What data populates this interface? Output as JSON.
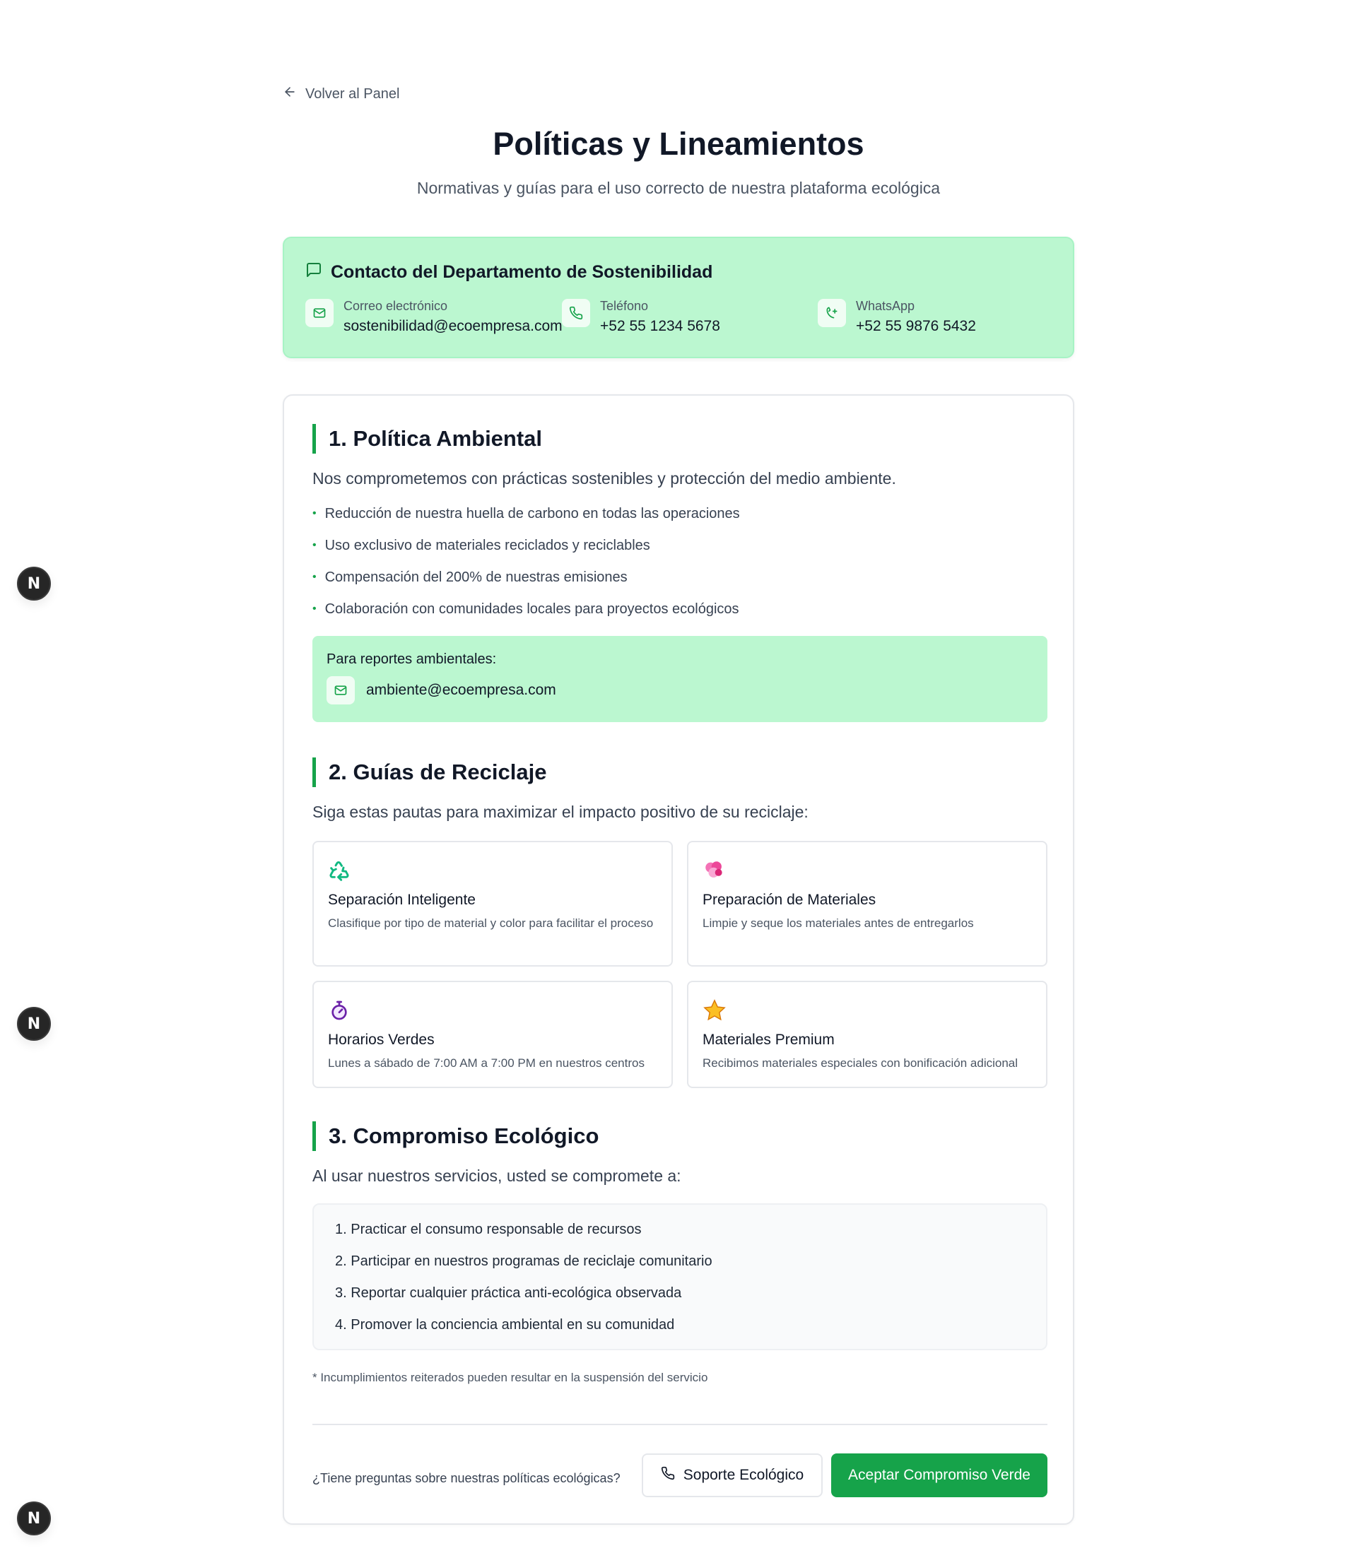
{
  "nav": {
    "back_label": "Volver al Panel"
  },
  "header": {
    "title": "Políticas y Lineamientos",
    "subtitle": "Normativas y guías para el uso correcto de nuestra plataforma ecológica"
  },
  "contact": {
    "title": "Contacto del Departamento de Sostenibilidad",
    "email_label": "Correo electrónico",
    "email_value": "sostenibilidad@ecoempresa.com",
    "phone_label": "Teléfono",
    "phone_value": "+52 55 1234 5678",
    "whatsapp_label": "WhatsApp",
    "whatsapp_value": "+52 55 9876 5432"
  },
  "section1": {
    "title": "1. Política Ambiental",
    "intro": "Nos comprometemos con prácticas sostenibles y protección del medio ambiente.",
    "bullets": [
      "Reducción de nuestra huella de carbono en todas las operaciones",
      "Uso exclusivo de materiales reciclados y reciclables",
      "Compensación del 200% de nuestras emisiones",
      "Colaboración con comunidades locales para proyectos ecológicos"
    ],
    "report_label": "Para reportes ambientales:",
    "report_email": "ambiente@ecoempresa.com"
  },
  "section2": {
    "title": "2. Guías de Reciclaje",
    "intro": "Siga estas pautas para maximizar el impacto positivo de su reciclaje:",
    "guides": [
      {
        "icon": "♻️",
        "title": "Separación Inteligente",
        "desc": "Clasifique por tipo de material y color para facilitar el proceso"
      },
      {
        "icon": "🧽",
        "title": "Preparación de Materiales",
        "desc": "Limpie y seque los materiales antes de entregarlos"
      },
      {
        "icon": "⏱",
        "title": "Horarios Verdes",
        "desc": "Lunes a sábado de 7:00 AM a 7:00 PM en nuestros centros"
      },
      {
        "icon": "⭐",
        "title": "Materiales Premium",
        "desc": "Recibimos materiales especiales con bonificación adicional"
      }
    ]
  },
  "section3": {
    "title": "3. Compromiso Ecológico",
    "intro": "Al usar nuestros servicios, usted se compromete a:",
    "items": [
      "1. Practicar el consumo responsable de recursos",
      "2. Participar en nuestros programas de reciclaje comunitario",
      "3. Reportar cualquier práctica anti-ecológica observada",
      "4. Promover la conciencia ambiental en su comunidad"
    ],
    "footnote": "* Incumplimientos reiterados pueden resultar en la suspensión del servicio"
  },
  "footer": {
    "question": "¿Tiene preguntas sobre nuestras políticas ecológicas?",
    "support_label": "Soporte Ecológico",
    "accept_label": "Aceptar Compromiso Verde"
  },
  "badges": {
    "letter": "N"
  },
  "colors": {
    "accent": "#16a34a",
    "mint": "#bbf7d0",
    "text": "#111827",
    "muted": "#4b5563"
  }
}
